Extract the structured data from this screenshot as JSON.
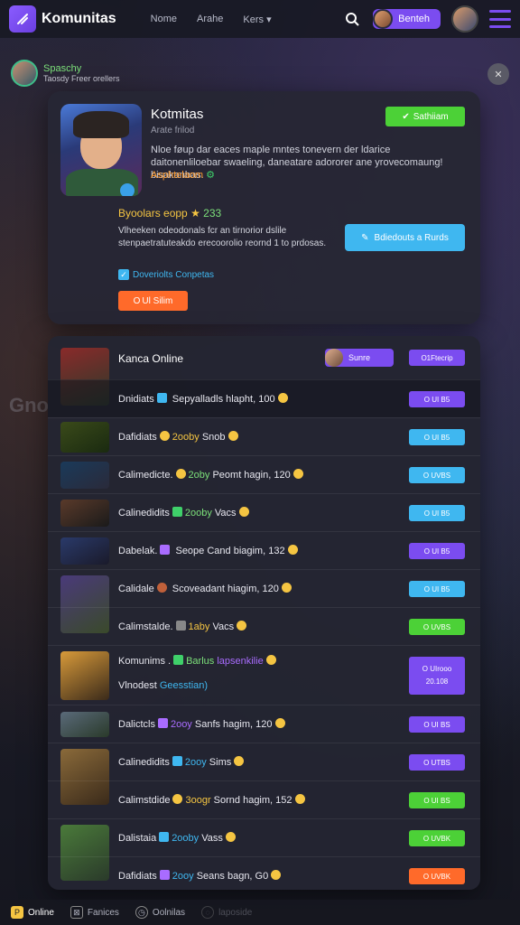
{
  "topbar": {
    "brand": "Komunitas",
    "nav": [
      "Nome",
      "Arahe",
      "Kers"
    ],
    "user_button": "Benteh",
    "icons": {
      "logo": "slash-logo-icon",
      "search": "search-icon",
      "menu": "hamburger-icon"
    }
  },
  "side": {
    "name": "Spaschy",
    "subtitle": "Taosdy Freer orellers",
    "watermark": "Gno"
  },
  "hero": {
    "title": "Kotmitas",
    "subtitle": "Arate frilod",
    "description": "Nloe føup dar eaces maple mntes tonevern der ldarice daitonenliloebar swaeling, daneatare adororer ane yrovecomaung! bisakanbas.",
    "tag": "Asphtelaom",
    "tag_icon": "⚙",
    "cta_green": "Sathiiam",
    "rating_text": "Byoolars eopp",
    "rating_value": "233",
    "body": "Vlheeken odeodonals fcr an tirnorior dslile stenpaetratuteakdo erecoorolio reornd 1 to prdosas.",
    "cta_blue": "Bdiedouts a Rurds",
    "checkbox_label": "Doveriolts Conpetas",
    "cta_orange": "O Ul Silim"
  },
  "list": {
    "title": "Kanca Online",
    "head_pill": "Sunre",
    "head_action": "O1Ftecrip",
    "rows": [
      {
        "name": "Dnidiats",
        "detail": "Sepyalladls hlapht, 100",
        "action": "O UI B5",
        "action_color": "#7b4cf0"
      },
      {
        "name": "Dafidiats",
        "detail_a": "2ooby",
        "detail_b": "Snob",
        "action": "O UI B5",
        "action_color": "#3fb7f0"
      },
      {
        "name": "Calimedicte.",
        "detail_a": "2oby",
        "detail_b": "Peomt hagin, 120",
        "action": "O UVBS",
        "action_color": "#3fb7f0"
      },
      {
        "name": "Calinedidits",
        "detail_a": "2ooby",
        "detail_b": "Vacs",
        "action": "O UI B5",
        "action_color": "#3fb7f0"
      },
      {
        "name": "Dabelak.",
        "detail": "Seope Cand biagim, 132",
        "action": "O UI B5",
        "action_color": "#7b4cf0"
      },
      {
        "name": "Calidale",
        "detail": "Scoveadant hiagim, 120",
        "action": "O UI B5",
        "action_color": "#3fb7f0"
      },
      {
        "name": "Calimstalde.",
        "detail_a": "1aby",
        "detail_b": "Vacs",
        "action": "O UVBS",
        "action_color": "#4cd137"
      },
      {
        "name": "Komunims .",
        "detail_a": "Barlus",
        "detail_b": "lapsenkilie",
        "sub_a": "Vlnodest",
        "sub_b": "Geesstian)",
        "action": "O UIrooo",
        "action2": "20.108",
        "action_color": "#7b4cf0"
      },
      {
        "name": "Dalictcls",
        "detail_a": "2ooy",
        "detail_b": "Sanfs hagim, 120",
        "action": "O UI BS",
        "action_color": "#7b4cf0"
      },
      {
        "name": "Calinedidits",
        "detail_a": "2ooy",
        "detail_b": "Sims",
        "action": "O UTBS",
        "action_color": "#7b4cf0"
      },
      {
        "name": "Calimstdide",
        "detail_a": "3oogr",
        "detail_b": "Sornd hagim, 152",
        "action": "O UI BS",
        "action_color": "#4cd137"
      },
      {
        "name": "Dalistaia",
        "detail_a": "2ooby",
        "detail_b": "Vass",
        "action": "O UVBK",
        "action_color": "#4cd137"
      },
      {
        "name": "Dafidiats",
        "detail_a": "2ooy",
        "detail_b": "Seans bagn, G0",
        "action": "O UVBK",
        "action_color": "#ff6a2a"
      }
    ]
  },
  "tabbar": {
    "items": [
      "Online",
      "Fanices",
      "Oolnilas",
      "laposide"
    ]
  }
}
